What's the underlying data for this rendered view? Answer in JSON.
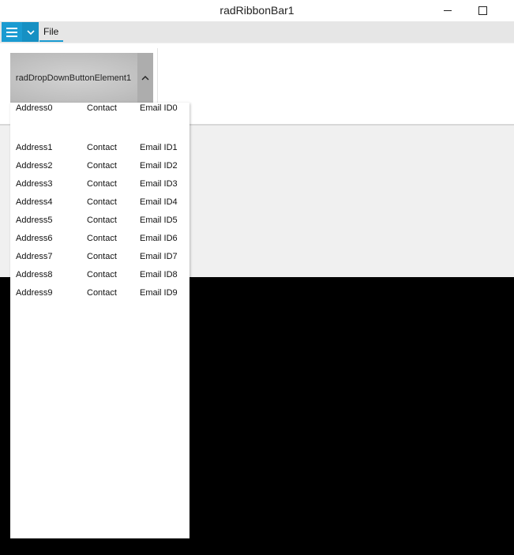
{
  "window": {
    "title": "radRibbonBar1",
    "minimize_icon": "minimize-icon",
    "maximize_icon": "maximize-icon"
  },
  "ribbon": {
    "app_menu_icon": "hamburger-menu-icon",
    "app_menu_dropdown_icon": "chevron-down-icon",
    "tabs": [
      {
        "label": "File",
        "selected": true
      }
    ],
    "accent_color": "#1a9bd1"
  },
  "dropdown_button": {
    "label": "radDropDownButtonElement1",
    "arrow_icon": "chevron-up-icon"
  },
  "popup": {
    "rows": [
      {
        "address": "Address0",
        "contact": "Contact",
        "email": "Email ID0"
      },
      {
        "address": "Address1",
        "contact": "Contact",
        "email": "Email ID1"
      },
      {
        "address": "Address2",
        "contact": "Contact",
        "email": "Email ID2"
      },
      {
        "address": "Address3",
        "contact": "Contact",
        "email": "Email ID3"
      },
      {
        "address": "Address4",
        "contact": "Contact",
        "email": "Email ID4"
      },
      {
        "address": "Address5",
        "contact": "Contact",
        "email": "Email ID5"
      },
      {
        "address": "Address6",
        "contact": "Contact",
        "email": "Email ID6"
      },
      {
        "address": "Address7",
        "contact": "Contact",
        "email": "Email ID7"
      },
      {
        "address": "Address8",
        "contact": "Contact",
        "email": "Email ID8"
      },
      {
        "address": "Address9",
        "contact": "Contact",
        "email": "Email ID9"
      }
    ]
  }
}
